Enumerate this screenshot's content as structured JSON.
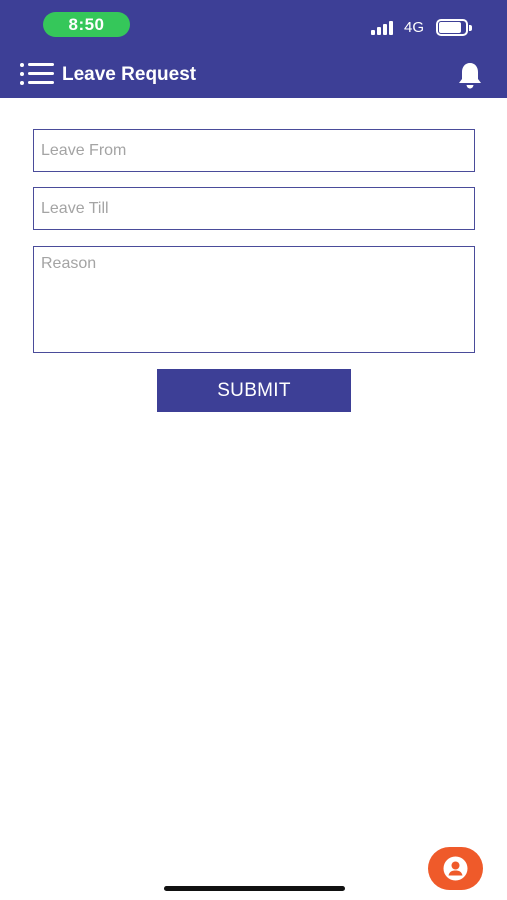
{
  "status_bar": {
    "time": "8:50",
    "network": "4G",
    "battery_level": 0.85,
    "signal_bars": 4
  },
  "app_bar": {
    "title": "Leave Request",
    "menu_icon": "menu-icon",
    "notification_icon": "bell-icon"
  },
  "form": {
    "leave_from": {
      "value": "",
      "placeholder": "Leave From"
    },
    "leave_till": {
      "value": "",
      "placeholder": "Leave Till"
    },
    "reason": {
      "value": "",
      "placeholder": "Reason"
    },
    "submit_label": "SUBMIT"
  },
  "fab": {
    "icon": "user-icon"
  },
  "colors": {
    "primary": "#3d3f96",
    "time_pill": "#35c75a",
    "fab": "#ef5a2a",
    "field_border": "#4a4c9a",
    "placeholder": "#a4a4a4"
  }
}
